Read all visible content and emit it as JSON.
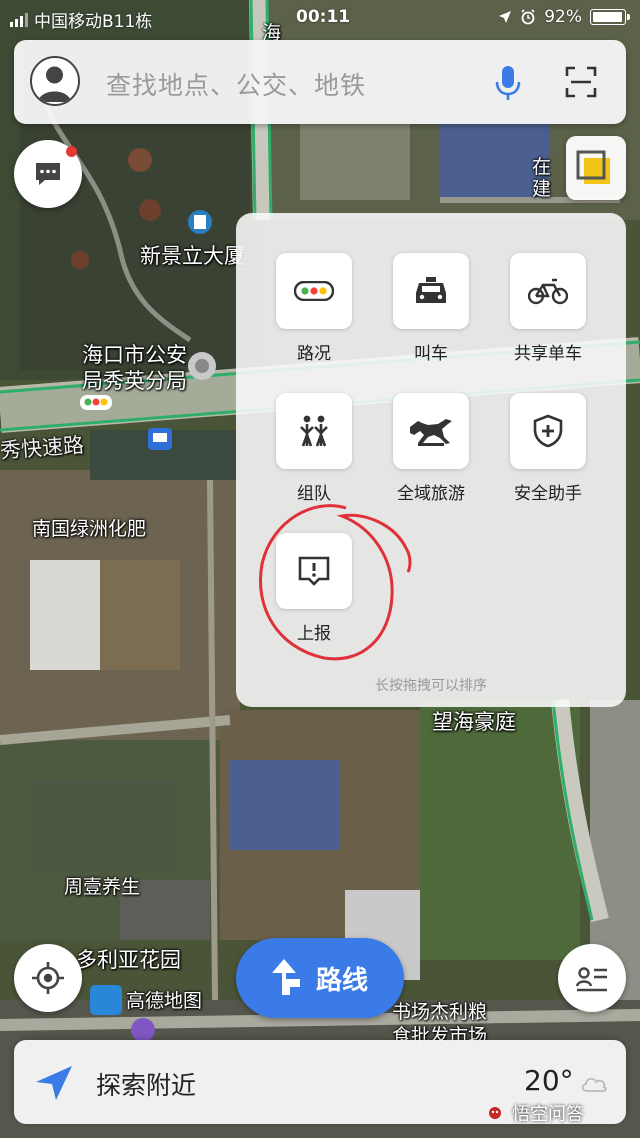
{
  "status_bar": {
    "carrier": "中国移动",
    "carrier_overlay": "B11栋",
    "time": "00:11",
    "battery": "92%"
  },
  "search": {
    "placeholder": "查找地点、公交、地铁",
    "avatar_icon": "user-avatar-icon",
    "mic_icon": "microphone-icon",
    "scan_icon": "scan-icon"
  },
  "map_labels": {
    "building_1": "新景立大厦",
    "police": "海口市公安\n局秀英分局",
    "expressway": "秀快速路",
    "fertilizer": "南国绿洲化肥",
    "wanghai": "望海豪庭",
    "zhouyi": "周壹养生",
    "victoria": "多利亚花园",
    "amap": "高德地图",
    "market": "书场杰利粮\n食批发市场",
    "top_hai": "海",
    "right_jian": "在建"
  },
  "tools": {
    "items": [
      {
        "label": "路况",
        "icon": "traffic-light-icon"
      },
      {
        "label": "叫车",
        "icon": "taxi-icon"
      },
      {
        "label": "共享单车",
        "icon": "bicycle-icon"
      },
      {
        "label": "组队",
        "icon": "team-icon"
      },
      {
        "label": "全域旅游",
        "icon": "horse-icon"
      },
      {
        "label": "安全助手",
        "icon": "shield-icon"
      },
      {
        "label": "上报",
        "icon": "report-icon"
      }
    ],
    "hint": "长按拖拽可以排序"
  },
  "route_button": {
    "label": "路线"
  },
  "nearby": {
    "label": "探索附近",
    "temperature": "20°"
  },
  "watermark": "悟空问答",
  "colors": {
    "accent_blue": "#3a7be8",
    "notification_red": "#e53935",
    "annotation_red": "#e0303a"
  }
}
